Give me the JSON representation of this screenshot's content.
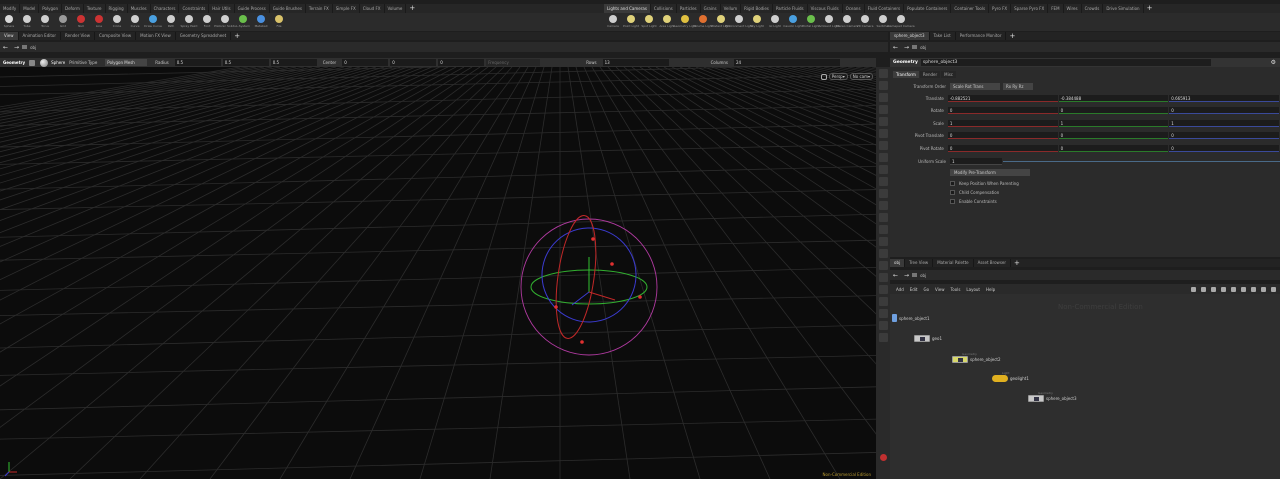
{
  "shelf_left": {
    "tabs": [
      "Modify",
      "Model",
      "Polygon",
      "Deform",
      "Texture",
      "Rigging",
      "Muscles",
      "Characters",
      "Constraints",
      "Hair Utils",
      "Guide Process",
      "Guide Brushes",
      "Terrain FX",
      "Simple FX",
      "Cloud FX",
      "Volume"
    ],
    "tools": [
      {
        "label": "Sphere",
        "icon": "sphere-icon",
        "color": "#d9d9d9"
      },
      {
        "label": "Tube",
        "icon": "tube-icon",
        "color": "#cfcfcf"
      },
      {
        "label": "Torus",
        "icon": "torus-icon",
        "color": "#cfcfcf"
      },
      {
        "label": "Grid",
        "icon": "grid-icon",
        "color": "#9a9a9a"
      },
      {
        "label": "Null",
        "icon": "null-icon",
        "color": "#cc3333"
      },
      {
        "label": "Line",
        "icon": "line-icon",
        "color": "#cc3333"
      },
      {
        "label": "Circle",
        "icon": "circle-icon",
        "color": "#cfcfcf"
      },
      {
        "label": "Curve",
        "icon": "curve-icon",
        "color": "#cfcfcf"
      },
      {
        "label": "Draw Curve",
        "icon": "draw-curve-icon",
        "color": "#4aa0e0"
      },
      {
        "label": "Path",
        "icon": "path-icon",
        "color": "#cfcfcf"
      },
      {
        "label": "Spray Paint",
        "icon": "spray-paint-icon",
        "color": "#cfcfcf"
      },
      {
        "label": "Font",
        "icon": "font-icon",
        "color": "#cfcfcf"
      },
      {
        "label": "Platonic Solids",
        "icon": "platonic-icon",
        "color": "#cfcfcf"
      },
      {
        "label": "L-System",
        "icon": "lsystem-icon",
        "color": "#6abf4b"
      },
      {
        "label": "Metaball",
        "icon": "metaball-icon",
        "color": "#4a90e0"
      },
      {
        "label": "File",
        "icon": "file-icon",
        "color": "#d9c26a"
      }
    ]
  },
  "shelf_right": {
    "tabs": [
      "Lights and Cameras",
      "Collisions",
      "Particles",
      "Grains",
      "Vellum",
      "Rigid Bodies",
      "Particle Fluids",
      "Viscous Fluids",
      "Oceans",
      "Fluid Containers",
      "Populate Containers",
      "Container Tools",
      "Pyro FX",
      "Sparse Pyro FX",
      "FEM",
      "Wires",
      "Crowds",
      "Drive Simulation"
    ],
    "tools": [
      {
        "label": "Camera",
        "icon": "camera-icon",
        "color": "#cfcfcf"
      },
      {
        "label": "Point Light",
        "icon": "point-light-icon",
        "color": "#e0d27a"
      },
      {
        "label": "Spot Light",
        "icon": "spot-light-icon",
        "color": "#e0d27a"
      },
      {
        "label": "Area Light",
        "icon": "area-light-icon",
        "color": "#e0d27a"
      },
      {
        "label": "Geometry Light",
        "icon": "geometry-light-icon",
        "color": "#e0c040"
      },
      {
        "label": "Volume Light",
        "icon": "volume-light-icon",
        "color": "#e07030"
      },
      {
        "label": "Distant Light",
        "icon": "distant-light-icon",
        "color": "#e0d27a"
      },
      {
        "label": "Environment Light",
        "icon": "environment-light-icon",
        "color": "#cfcfcf"
      },
      {
        "label": "Sky Light",
        "icon": "sky-light-icon",
        "color": "#e0d27a"
      },
      {
        "label": "GI Light",
        "icon": "gi-light-icon",
        "color": "#cfcfcf"
      },
      {
        "label": "Caustic Light",
        "icon": "caustic-light-icon",
        "color": "#4aa0e0"
      },
      {
        "label": "Portal Light",
        "icon": "portal-light-icon",
        "color": "#6abf4b"
      },
      {
        "label": "Ambient Light",
        "icon": "ambient-light-icon",
        "color": "#cfcfcf"
      },
      {
        "label": "Stereo Camera",
        "icon": "stereo-camera-icon",
        "color": "#cfcfcf"
      },
      {
        "label": "VR Camera",
        "icon": "vr-camera-icon",
        "color": "#cfcfcf"
      },
      {
        "label": "Switcher",
        "icon": "switcher-icon",
        "color": "#cfcfcf"
      },
      {
        "label": "Gamepad Camera",
        "icon": "gamepad-camera-icon",
        "color": "#cfcfcf"
      }
    ]
  },
  "left_panes": {
    "tabs": [
      "View",
      "Animation Editor",
      "Render View",
      "Composite View",
      "Motion FX View",
      "Geometry Spreadsheet"
    ],
    "path": "obj"
  },
  "viewport_toolbar": {
    "context": "Geometry",
    "node": "Sphere",
    "primitive_type_label": "Primitive Type",
    "primitive_type": "Polygon Mesh",
    "radius_label": "Radius",
    "radius": [
      "0.5",
      "0.5",
      "0.5"
    ],
    "center_label": "Center",
    "center": [
      "0",
      "0",
      "0"
    ],
    "frequency_label": "Frequency",
    "rows_label": "Rows",
    "rows": "13",
    "columns_label": "Columns",
    "columns": "24"
  },
  "viewport": {
    "persp": "Persp▾",
    "cam": "No cam▾",
    "watermark": "Non-Commercial Edition"
  },
  "right_top": {
    "tabs": [
      "sphere_object3",
      "Take List",
      "Performance Monitor"
    ],
    "path": "obj",
    "header_type": "Geometry",
    "header_name": "sphere_object3",
    "subtabs": [
      "Transform",
      "Render",
      "Misc"
    ],
    "transform_order_label": "Transform Order",
    "transform_order": "Scale Rot Trans",
    "rot_order": "Rx Ry Rz",
    "params": [
      {
        "label": "Translate",
        "values": [
          "-0.882521",
          "-0.384488",
          "0.665913"
        ]
      },
      {
        "label": "Rotate",
        "values": [
          "0",
          "0",
          "0"
        ]
      },
      {
        "label": "Scale",
        "values": [
          "1",
          "1",
          "1"
        ]
      },
      {
        "label": "Pivot Translate",
        "values": [
          "0",
          "0",
          "0"
        ]
      },
      {
        "label": "Pivot Rotate",
        "values": [
          "0",
          "0",
          "0"
        ]
      }
    ],
    "uniform_scale_label": "Uniform Scale",
    "uniform_scale": "1",
    "modify_btn": "Modify Pre-Transform",
    "checks": [
      "Keep Position When Parenting",
      "Child Compensation",
      "Enable Constraints"
    ]
  },
  "network": {
    "tabs": [
      "obj",
      "Tree View",
      "Material Palette",
      "Asset Browser"
    ],
    "path": "obj",
    "menu": [
      "Add",
      "Edit",
      "Go",
      "View",
      "Tools",
      "Layout",
      "Help"
    ],
    "watermark": "Non-Commercial Edition",
    "nodes": [
      {
        "name": "sphere_object1",
        "caption": ""
      },
      {
        "name": "geo1",
        "caption": ""
      },
      {
        "name": "sphere_object2",
        "caption": "Geometry"
      },
      {
        "name": "geolight1",
        "caption": "Light"
      },
      {
        "name": "sphere_object3",
        "caption": "Geometry"
      }
    ]
  }
}
